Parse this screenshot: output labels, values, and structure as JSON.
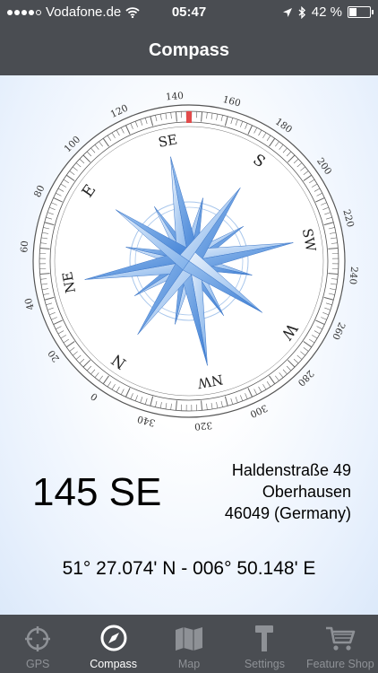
{
  "status": {
    "carrier": "Vodafone.de",
    "time": "05:47",
    "battery": "42 %",
    "battery_fraction": 0.42
  },
  "nav": {
    "title": "Compass"
  },
  "compass": {
    "heading_deg": 145,
    "degree_labels": [
      "0",
      "20",
      "40",
      "60",
      "80",
      "100",
      "120",
      "140",
      "160",
      "180",
      "200",
      "220",
      "240",
      "260",
      "280",
      "300",
      "320",
      "340"
    ],
    "directions": {
      "N": "N",
      "NE": "NE",
      "E": "E",
      "SE": "SE",
      "S": "S",
      "SW": "SW",
      "W": "W",
      "NW": "NW"
    }
  },
  "readout": {
    "heading_text": "145 SE",
    "street": "Haldenstraße 49",
    "city": "Oberhausen",
    "postal": "46049 (Germany)",
    "coords": "51° 27.074' N - 006° 50.148' E"
  },
  "tabs": [
    {
      "label": "GPS",
      "icon": "crosshair-icon"
    },
    {
      "label": "Compass",
      "icon": "compass-icon",
      "active": true
    },
    {
      "label": "Map",
      "icon": "map-icon"
    },
    {
      "label": "Settings",
      "icon": "hammer-icon"
    },
    {
      "label": "Feature Shop",
      "icon": "cart-icon"
    }
  ],
  "colors": {
    "bar": "#4a4d52",
    "accent_marker": "#e24b4b",
    "rose_blue": "#4f8fdc"
  }
}
